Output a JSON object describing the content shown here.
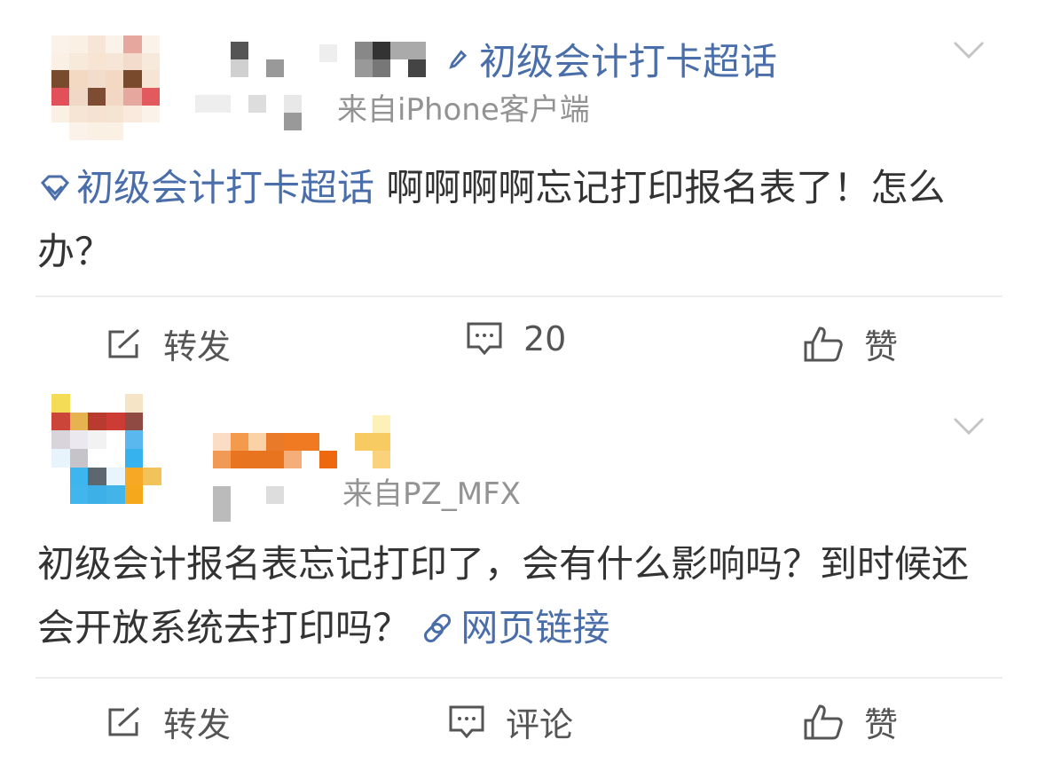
{
  "posts": [
    {
      "topic_label": "初级会计打卡超话",
      "source": "来自iPhone客户端",
      "body_topic": "初级会计打卡超话",
      "body_text": " 啊啊啊啊忘记打印报名表了！怎么办？",
      "actions": {
        "repost": "转发",
        "comment": "20",
        "like": "赞"
      }
    },
    {
      "source": "来自PZ_MFX",
      "body_text": "初级会计报名表忘记打印了，会有什么影响吗？到时候还会开放系统去打印吗？",
      "body_link": "网页链接",
      "actions": {
        "repost": "转发",
        "comment": "评论",
        "like": "赞"
      }
    }
  ],
  "colors": {
    "link": "#4a6ea9",
    "secondary": "#939393",
    "text": "#333333",
    "divider": "#eeeeee"
  },
  "icons": [
    "diamond-icon",
    "link-icon",
    "chevron-down-icon",
    "repost-icon",
    "comment-icon",
    "like-icon"
  ]
}
